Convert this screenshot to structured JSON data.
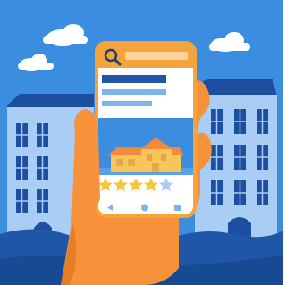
{
  "colors": {
    "sky": "#3b8de0",
    "cloud": "#ffffff",
    "building_light": "#a9cdf4",
    "building_dark": "#1c4fa0",
    "window": "#1c4fa0",
    "ground": "#1f56a8",
    "hand": "#f7923a",
    "hand_shade": "#e47d28",
    "phone_frame": "#f5a33b",
    "phone_screen": "#ffffff",
    "header_bar": "#f5a33b",
    "text_block_dark": "#1f56a8",
    "text_block_light": "#7fb3ec",
    "photo_bg": "#3b8de0",
    "house_wall": "#f6c65b",
    "house_roof": "#f28a3a",
    "star_filled": "#f6c540",
    "star_empty": "#a9cdf4",
    "nav_icon": "#7fb3ec"
  },
  "phone": {
    "search_icon": "search-icon",
    "rating": {
      "value": 4,
      "max": 5
    },
    "nav_icons": [
      "back-icon",
      "home-icon",
      "recent-apps-icon"
    ]
  }
}
